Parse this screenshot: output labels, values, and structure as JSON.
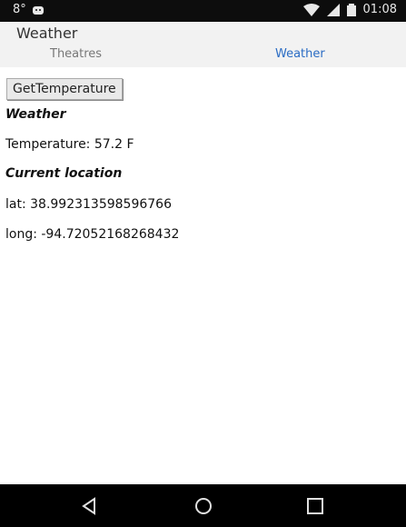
{
  "status_bar": {
    "temperature": "8°",
    "time": "01:08"
  },
  "app": {
    "title": "Weather",
    "tabs": [
      {
        "label": "Theatres",
        "active": false
      },
      {
        "label": "Weather",
        "active": true
      }
    ]
  },
  "main": {
    "button_label": "GetTemperature",
    "weather_heading": "Weather",
    "temperature_text": "Temperature: 57.2 F",
    "location_heading": "Current location",
    "lat_text": "lat: 38.992313598596766",
    "long_text": "long: -94.72052168268432"
  },
  "nav": {
    "icons": [
      "back-icon",
      "home-icon",
      "recents-icon"
    ]
  },
  "colors": {
    "status_bar_bg": "#0d0d0d",
    "header_bg": "#f2f2f2",
    "active_tab": "#2a6cc4",
    "inactive_tab": "#777777",
    "nav_bar_bg": "#000000"
  }
}
